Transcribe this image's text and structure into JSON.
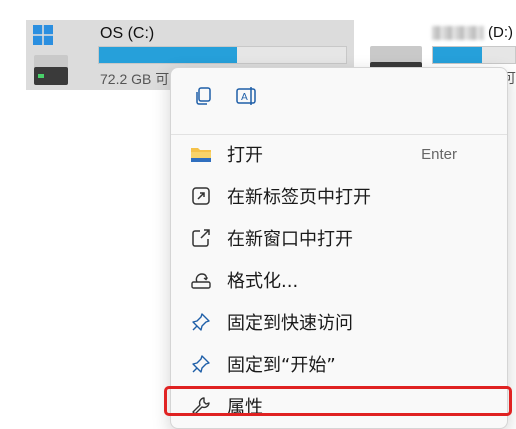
{
  "drives": [
    {
      "name": "OS (C:)",
      "free_text": "72.2 GB 可",
      "used_fraction": 0.56,
      "selected": true,
      "icons": [
        "windows-logo-icon",
        "hard-drive-icon"
      ]
    },
    {
      "name_suffix": "(D:)",
      "used_fraction": 0.6,
      "free_text": "可",
      "icons": [
        "hard-drive-icon"
      ]
    }
  ],
  "context_menu": {
    "quick_actions": [
      {
        "name": "copy-icon"
      },
      {
        "name": "rename-icon"
      }
    ],
    "items": [
      {
        "label": "打开",
        "shortcut": "Enter",
        "icon": "folder-icon"
      },
      {
        "label": "在新标签页中打开",
        "icon": "open-new-tab-icon"
      },
      {
        "label": "在新窗口中打开",
        "icon": "open-new-window-icon"
      },
      {
        "label": "格式化...",
        "icon": "format-drive-icon"
      },
      {
        "label": "固定到快速访问",
        "icon": "pin-icon"
      },
      {
        "label": "固定到“开始”",
        "icon": "pin-icon"
      },
      {
        "label": "属性",
        "icon": "wrench-icon"
      }
    ]
  },
  "colors": {
    "accent": "#26a0da",
    "highlight_border": "#e02222",
    "selection_bg": "#dcdcdc"
  }
}
